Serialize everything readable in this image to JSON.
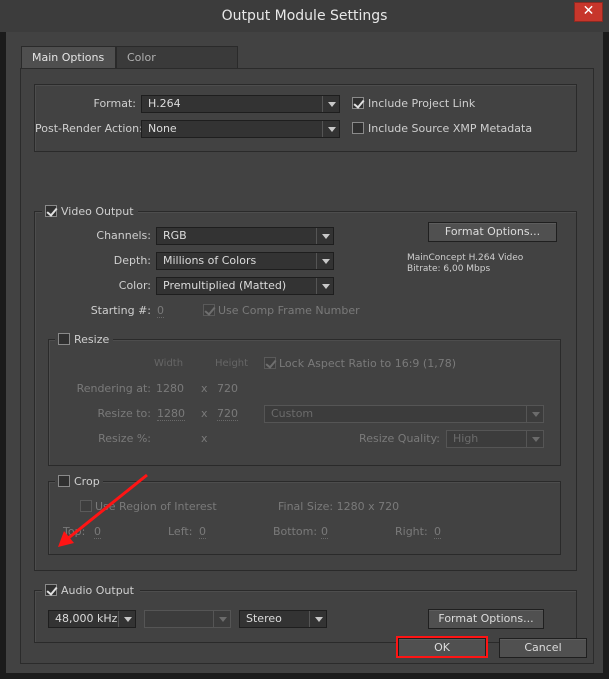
{
  "window": {
    "title": "Output Module Settings",
    "close_glyph": "✕"
  },
  "tabs": [
    {
      "label": "Main Options",
      "active": true
    },
    {
      "label": "Color Management",
      "active": false
    }
  ],
  "format_section": {
    "format_label": "Format:",
    "format_value": "H.264",
    "post_render_label": "Post-Render Action:",
    "post_render_value": "None",
    "include_project_link": {
      "label": "Include Project Link",
      "checked": true
    },
    "include_xmp": {
      "label": "Include Source XMP Metadata",
      "checked": false
    }
  },
  "video_output": {
    "label": "Video Output",
    "checked": true,
    "channels_label": "Channels:",
    "channels_value": "RGB",
    "depth_label": "Depth:",
    "depth_value": "Millions of Colors",
    "color_label": "Color:",
    "color_value": "Premultiplied (Matted)",
    "starting_label": "Starting #:",
    "starting_value": "0",
    "use_comp_frame": {
      "label": "Use Comp Frame Number",
      "checked": true,
      "disabled": true
    },
    "format_options_label": "Format Options...",
    "codec_info_line1": "MainConcept H.264 Video",
    "codec_info_line2": "Bitrate: 6,00 Mbps"
  },
  "resize": {
    "label": "Resize",
    "checked": false,
    "width_header": "Width",
    "height_header": "Height",
    "lock_aspect": {
      "label": "Lock Aspect Ratio to 16:9 (1,78)",
      "checked": true,
      "disabled": true
    },
    "rendering_at_label": "Rendering at:",
    "rendering_width": "1280",
    "rendering_x": "x",
    "rendering_height": "720",
    "resize_to_label": "Resize to:",
    "resize_to_width": "1280",
    "resize_to_x": "x",
    "resize_to_height": "720",
    "resize_to_preset": "Custom",
    "resize_pct_label": "Resize %:",
    "resize_pct_x": "x",
    "quality_label": "Resize Quality:",
    "quality_value": "High"
  },
  "crop": {
    "label": "Crop",
    "checked": false,
    "use_roi": {
      "label": "Use Region of Interest",
      "checked": false,
      "disabled": true
    },
    "final_size": "Final Size: 1280 x 720",
    "top_label": "Top:",
    "top_value": "0",
    "left_label": "Left:",
    "left_value": "0",
    "bottom_label": "Bottom:",
    "bottom_value": "0",
    "right_label": "Right:",
    "right_value": "0"
  },
  "audio_output": {
    "label": "Audio Output",
    "checked": true,
    "sample_rate": "48,000 kHz",
    "bit_depth": "",
    "channels": "Stereo",
    "format_options_label": "Format Options..."
  },
  "footer": {
    "ok_label": "OK",
    "cancel_label": "Cancel"
  },
  "annotations": {
    "highlight_color": "#ff1414",
    "arrow_color": "#ff1414"
  }
}
